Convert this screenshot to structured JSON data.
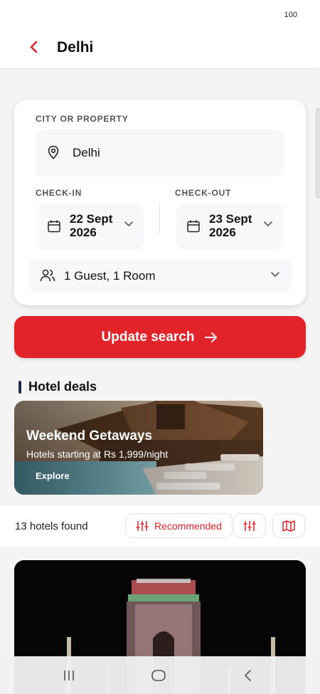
{
  "status": {
    "battery": "100"
  },
  "header": {
    "title": "Delhi",
    "back_icon": "chevron-left-icon"
  },
  "search": {
    "city_label": "CITY OR PROPERTY",
    "city_value": "Delhi",
    "checkin_label": "CHECK-IN",
    "checkin_value": "22 Sept 2026",
    "checkout_label": "CHECK-OUT",
    "checkout_value": "23 Sept 2026",
    "guests_value": "1 Guest, 1 Room"
  },
  "update_button": {
    "label": "Update search"
  },
  "deals": {
    "section_title": "Hotel deals",
    "card": {
      "title": "Weekend Getaways",
      "subtitle": "Hotels starting at Rs 1,999/night",
      "cta": "Explore"
    }
  },
  "results": {
    "count_text": "13 hotels found",
    "sort_label": "Recommended"
  },
  "colors": {
    "accent": "#e2232a",
    "section_bar": "#1f2a44"
  }
}
